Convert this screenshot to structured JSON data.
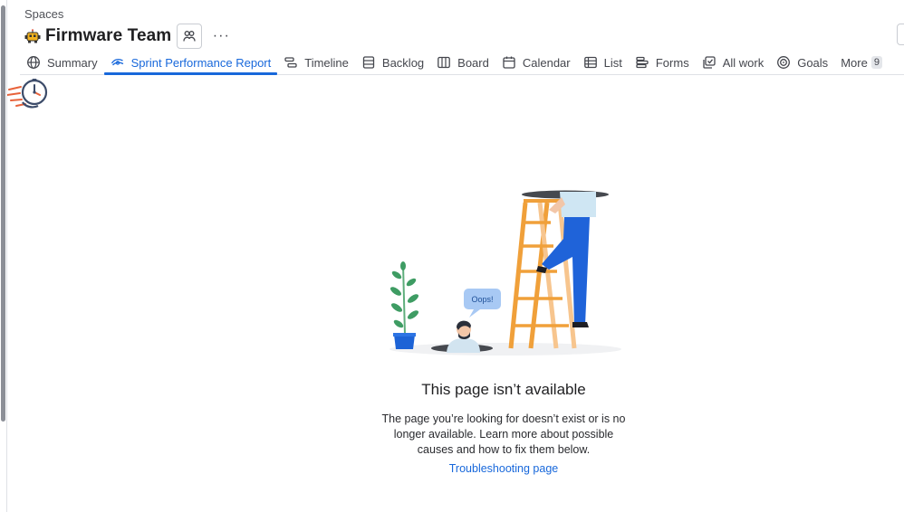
{
  "breadcrumb": "Spaces",
  "space": {
    "title": "Firmware Team",
    "icon": "robot-icon",
    "more_label": "···"
  },
  "tabs": [
    {
      "label": "Summary",
      "icon": "globe-icon",
      "active": false
    },
    {
      "label": "Sprint Performance Report",
      "icon": "eye-icon",
      "active": true
    },
    {
      "label": "Timeline",
      "icon": "timeline-icon",
      "active": false
    },
    {
      "label": "Backlog",
      "icon": "backlog-icon",
      "active": false
    },
    {
      "label": "Board",
      "icon": "board-icon",
      "active": false
    },
    {
      "label": "Calendar",
      "icon": "calendar-icon",
      "active": false
    },
    {
      "label": "List",
      "icon": "list-icon",
      "active": false
    },
    {
      "label": "Forms",
      "icon": "forms-icon",
      "active": false
    },
    {
      "label": "All work",
      "icon": "all-work-icon",
      "active": false
    },
    {
      "label": "Goals",
      "icon": "goals-icon",
      "active": false
    },
    {
      "label": "More",
      "count": "9",
      "active": false
    }
  ],
  "illustration": {
    "speech_bubble": "Oops!"
  },
  "error": {
    "title": "This page isn’t available",
    "body": "The page you’re looking for doesn’t exist or is no longer available. Learn more about possible causes and how to fix them below.",
    "link": "Troubleshooting page"
  },
  "colors": {
    "accent": "#1868db",
    "text": "#292a2e",
    "border": "#dfe1e6"
  }
}
